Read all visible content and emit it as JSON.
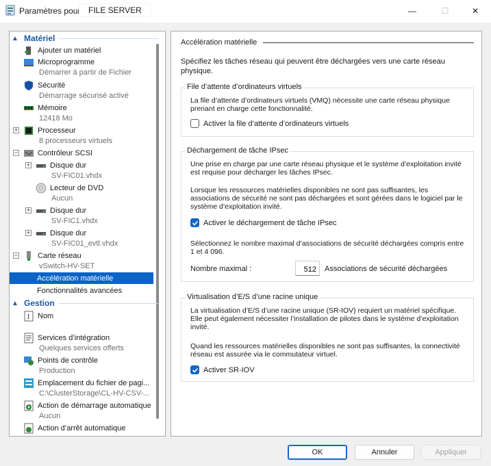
{
  "window": {
    "title_prefix": "Paramètres pour",
    "server_name": "FILE SERVER",
    "minimize": "—",
    "maximize": "☐",
    "close": "✕"
  },
  "sidebar": {
    "hardware_header": "Matériel",
    "management_header": "Gestion",
    "items": [
      {
        "label": "Ajouter un matériel",
        "sub": ""
      },
      {
        "label": "Microprogramme",
        "sub": "Démarrer à partir de Fichier"
      },
      {
        "label": "Sécurité",
        "sub": "Démarrage sécurisé activé"
      },
      {
        "label": "Mémoire",
        "sub": "12418 Mo"
      },
      {
        "label": "Processeur",
        "sub": "8 processeurs virtuels"
      },
      {
        "label": "Contrôleur SCSI",
        "sub": ""
      },
      {
        "label": "Disque dur",
        "sub": "SV-FIC01.vhdx"
      },
      {
        "label": "Lecteur de DVD",
        "sub": "Aucun"
      },
      {
        "label": "Disque dur",
        "sub": "SV-FIC1.vhdx"
      },
      {
        "label": "Disque dur",
        "sub": "SV-FIC01_evtl.vhdx"
      },
      {
        "label": "Carte réseau",
        "sub": "vSwitch-HV-SET"
      },
      {
        "label": "Accélération matérielle",
        "sub": ""
      },
      {
        "label": "Fonctionnalités avancées",
        "sub": ""
      },
      {
        "label": "Nom",
        "sub": ""
      },
      {
        "label": "Services d’intégration",
        "sub": "Quelques services offerts"
      },
      {
        "label": "Points de contrôle",
        "sub": "Production"
      },
      {
        "label": "Emplacement du fichier de pagi...",
        "sub": "C:\\ClusterStorage\\CL-HV-CSV-..."
      },
      {
        "label": "Action de démarrage automatique",
        "sub": "Aucun"
      },
      {
        "label": "Action d’arrêt automatique",
        "sub": ""
      }
    ]
  },
  "main": {
    "title": "Accélération matérielle",
    "description": "Spécifiez les tâches réseau qui peuvent être déchargées vers une carte réseau physique.",
    "vmq": {
      "label": "File d’attente d’ordinateurs virtuels",
      "text": "La file d’attente d’ordinateurs virtuels (VMQ) nécessite une carte réseau physique prenant en charge cette fonctionnalité.",
      "checkbox_label": "Activer la file d’attente d’ordinateurs virtuels",
      "checked": false
    },
    "ipsec": {
      "label": "Déchargement de tâche IPsec",
      "text1": "Une prise en charge par une carte réseau physique et le système d’exploitation invité est requise pour décharger les tâches IPsec.",
      "text2": "Lorsque les ressources matérielles disponibles ne sont pas suffisantes, les associations de sécurité ne sont pas déchargées et sont gérées dans le logiciel par le système d’exploitation invité.",
      "checkbox_label": "Activer le déchargement de tâche IPsec",
      "checked": true,
      "text3": "Sélectionnez le nombre maximal d’associations de sécurité déchargées compris entre 1 et 4 096.",
      "max_label": "Nombre maximal :",
      "max_value": "512",
      "max_suffix": "Associations de sécurité déchargées"
    },
    "sriov": {
      "label": "Virtualisation d’E/S d’une racine unique",
      "text1": "La virtualisation d’E/S d’une racine unique (SR-IOV) requiert un matériel spécifique. Elle peut également nécessiter l’installation de pilotes dans le système d’exploitation invité.",
      "text2": "Quand les ressources matérielles disponibles ne sont pas suffisantes, la connectivité réseau est assurée via le commutateur virtuel.",
      "checkbox_label": "Activer SR-IOV",
      "checked": true
    }
  },
  "buttons": {
    "ok": "OK",
    "cancel": "Annuler",
    "apply": "Appliquer"
  },
  "colors": {
    "accent": "#1666c5",
    "selection": "#0a64c8",
    "section_header": "#1c5aa3"
  }
}
